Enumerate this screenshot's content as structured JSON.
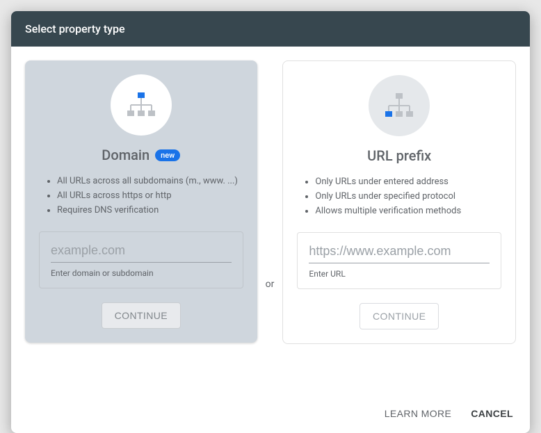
{
  "modal": {
    "title": "Select property type",
    "or_label": "or",
    "learn_more": "LEARN MORE",
    "cancel": "CANCEL"
  },
  "domain_card": {
    "title": "Domain",
    "badge": "new",
    "bullets": [
      "All URLs across all subdomains (m., www. ...)",
      "All URLs across https or http",
      "Requires DNS verification"
    ],
    "input_placeholder": "example.com",
    "input_value": "",
    "helper": "Enter domain or subdomain",
    "continue": "CONTINUE"
  },
  "url_card": {
    "title": "URL prefix",
    "bullets": [
      "Only URLs under entered address",
      "Only URLs under specified protocol",
      "Allows multiple verification methods"
    ],
    "input_placeholder": "https://www.example.com",
    "input_value": "",
    "helper": "Enter URL",
    "continue": "CONTINUE"
  }
}
